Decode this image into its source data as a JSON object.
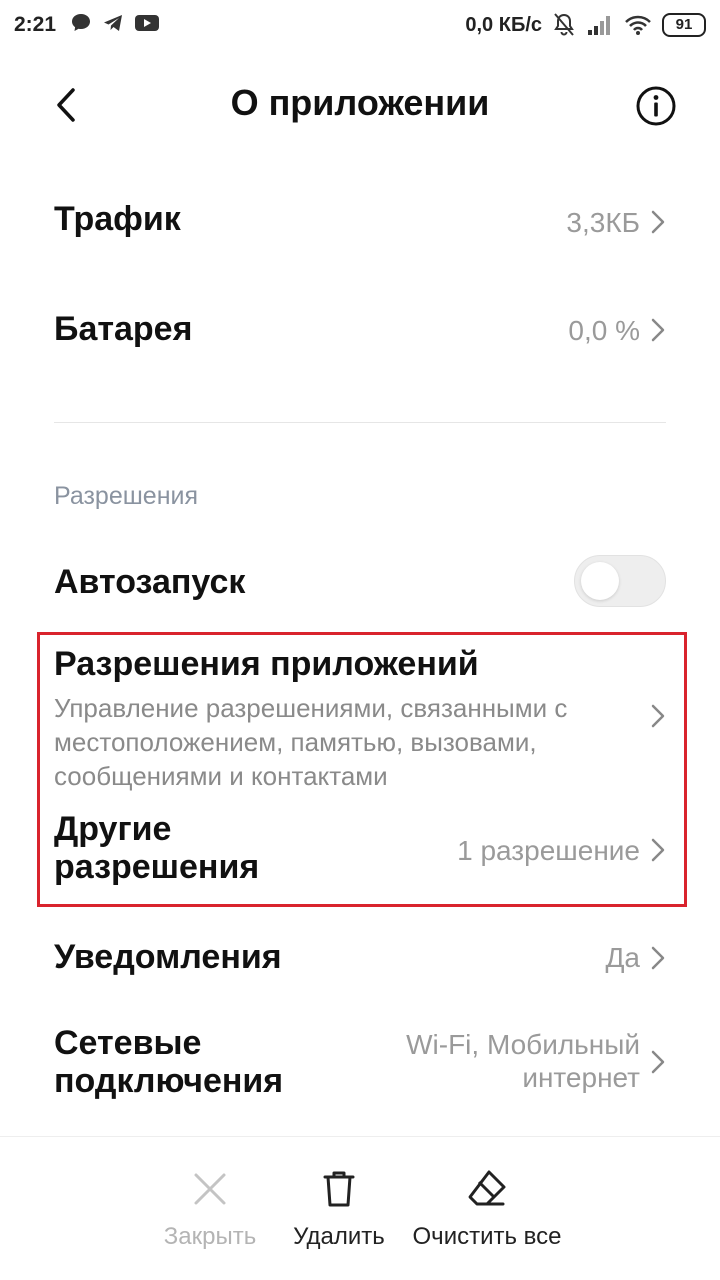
{
  "status_bar": {
    "time": "2:21",
    "speed": "0,0 КБ/с",
    "battery": "91"
  },
  "header": {
    "title": "О приложении"
  },
  "rows": {
    "traffic": {
      "label": "Трафик",
      "value": "3,3КБ"
    },
    "battery": {
      "label": "Батарея",
      "value": "0,0 %"
    }
  },
  "permissions_section": {
    "label": "Разрешения",
    "autostart": {
      "label": "Автозапуск",
      "enabled": false
    },
    "app_permissions": {
      "label": "Разрешения приложений",
      "description": "Управление разрешениями, связанными с местоположением, памятью, вызовами, сообщениями и контактами"
    },
    "other_permissions": {
      "label_line1": "Другие",
      "label_line2": "разрешения",
      "value": "1 разрешение"
    }
  },
  "notifications": {
    "label": "Уведомления",
    "value": "Да"
  },
  "network": {
    "label_line1": "Сетевые",
    "label_line2": "подключения",
    "value_line1": "Wi-Fi, Мобильный",
    "value_line2": "интернет"
  },
  "bottom_bar": {
    "close_label": "Закрыть",
    "delete_label": "Удалить",
    "clear_label": "Очистить все"
  },
  "colors": {
    "highlight": "#d9232d",
    "muted_text": "#9a9a9a",
    "section_label": "#8a93a0"
  }
}
